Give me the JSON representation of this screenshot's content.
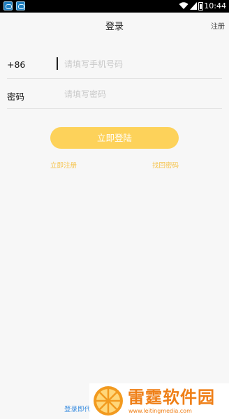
{
  "status_bar": {
    "time": "10:44",
    "icons": [
      "app-icon",
      "app-icon",
      "wifi-icon",
      "signal-icon",
      "battery-icon"
    ]
  },
  "nav": {
    "title": "登录",
    "register_label": "注册"
  },
  "form": {
    "phone": {
      "label": "+86",
      "value": "",
      "placeholder": "请填写手机号码"
    },
    "password": {
      "label": "密码",
      "value": "",
      "placeholder": "请填写密码"
    }
  },
  "actions": {
    "login_label": "立即登陆",
    "register_link": "立即注册",
    "forgot_link": "找回密码"
  },
  "footer": {
    "agreement_text": "登录即代"
  },
  "watermark": {
    "title": "雷霆软件园",
    "url": "www.leitingmedia.com",
    "icon": "orange-slice-logo"
  },
  "colors": {
    "accent": "#fdd25a",
    "link": "#f6c248",
    "agreement": "#3b8ee0",
    "watermark": "#ef7f17"
  }
}
